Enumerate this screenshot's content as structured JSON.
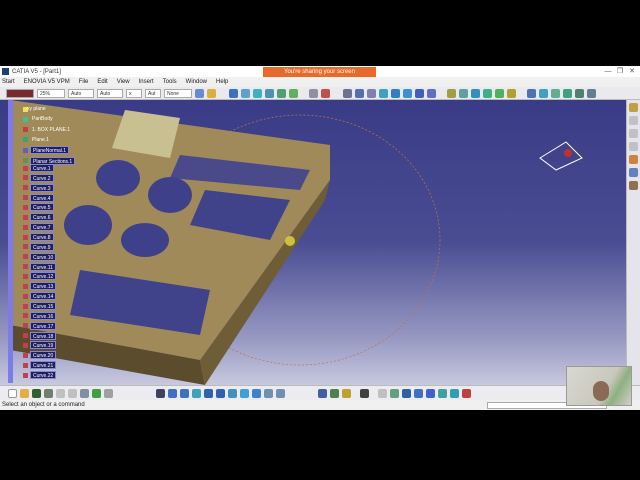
{
  "window": {
    "title": "CATIA V5 - [Part1]",
    "share_banner": "You're sharing your screen",
    "controls": [
      "—",
      "❐",
      "✕"
    ]
  },
  "menu": [
    "Start",
    "ENOVIA V5 VPM",
    "File",
    "Edit",
    "View",
    "Insert",
    "Tools",
    "Window",
    "Help"
  ],
  "toolbar": {
    "color": "#7a2a2a",
    "transparency": "25%",
    "linetype": "Auto",
    "thickness": "Auto",
    "point": "x",
    "layer": "Aut",
    "render": "None"
  },
  "tree": {
    "items": [
      "xy plane",
      "PartBody",
      "1. BOX PLANE.1",
      "Plane.1",
      "PlaneNormal.1",
      "Planar Sections.1",
      "Curve.1",
      "Curve.2",
      "Curve.3",
      "Curve.4",
      "Curve.5",
      "Curve.6",
      "Curve.7",
      "Curve.8",
      "Curve.9",
      "Curve.10",
      "Curve.11",
      "Curve.12",
      "Curve.13",
      "Curve.14",
      "Curve.15",
      "Curve.16",
      "Curve.17",
      "Curve.18",
      "Curve.19",
      "Curve.20",
      "Curve.21",
      "Curve.22"
    ]
  },
  "status": {
    "text": "Select an object or a command"
  },
  "colors": {
    "part": "#a08a5a",
    "viewport_top": "#3a3b86",
    "accent": "#e8692a"
  }
}
